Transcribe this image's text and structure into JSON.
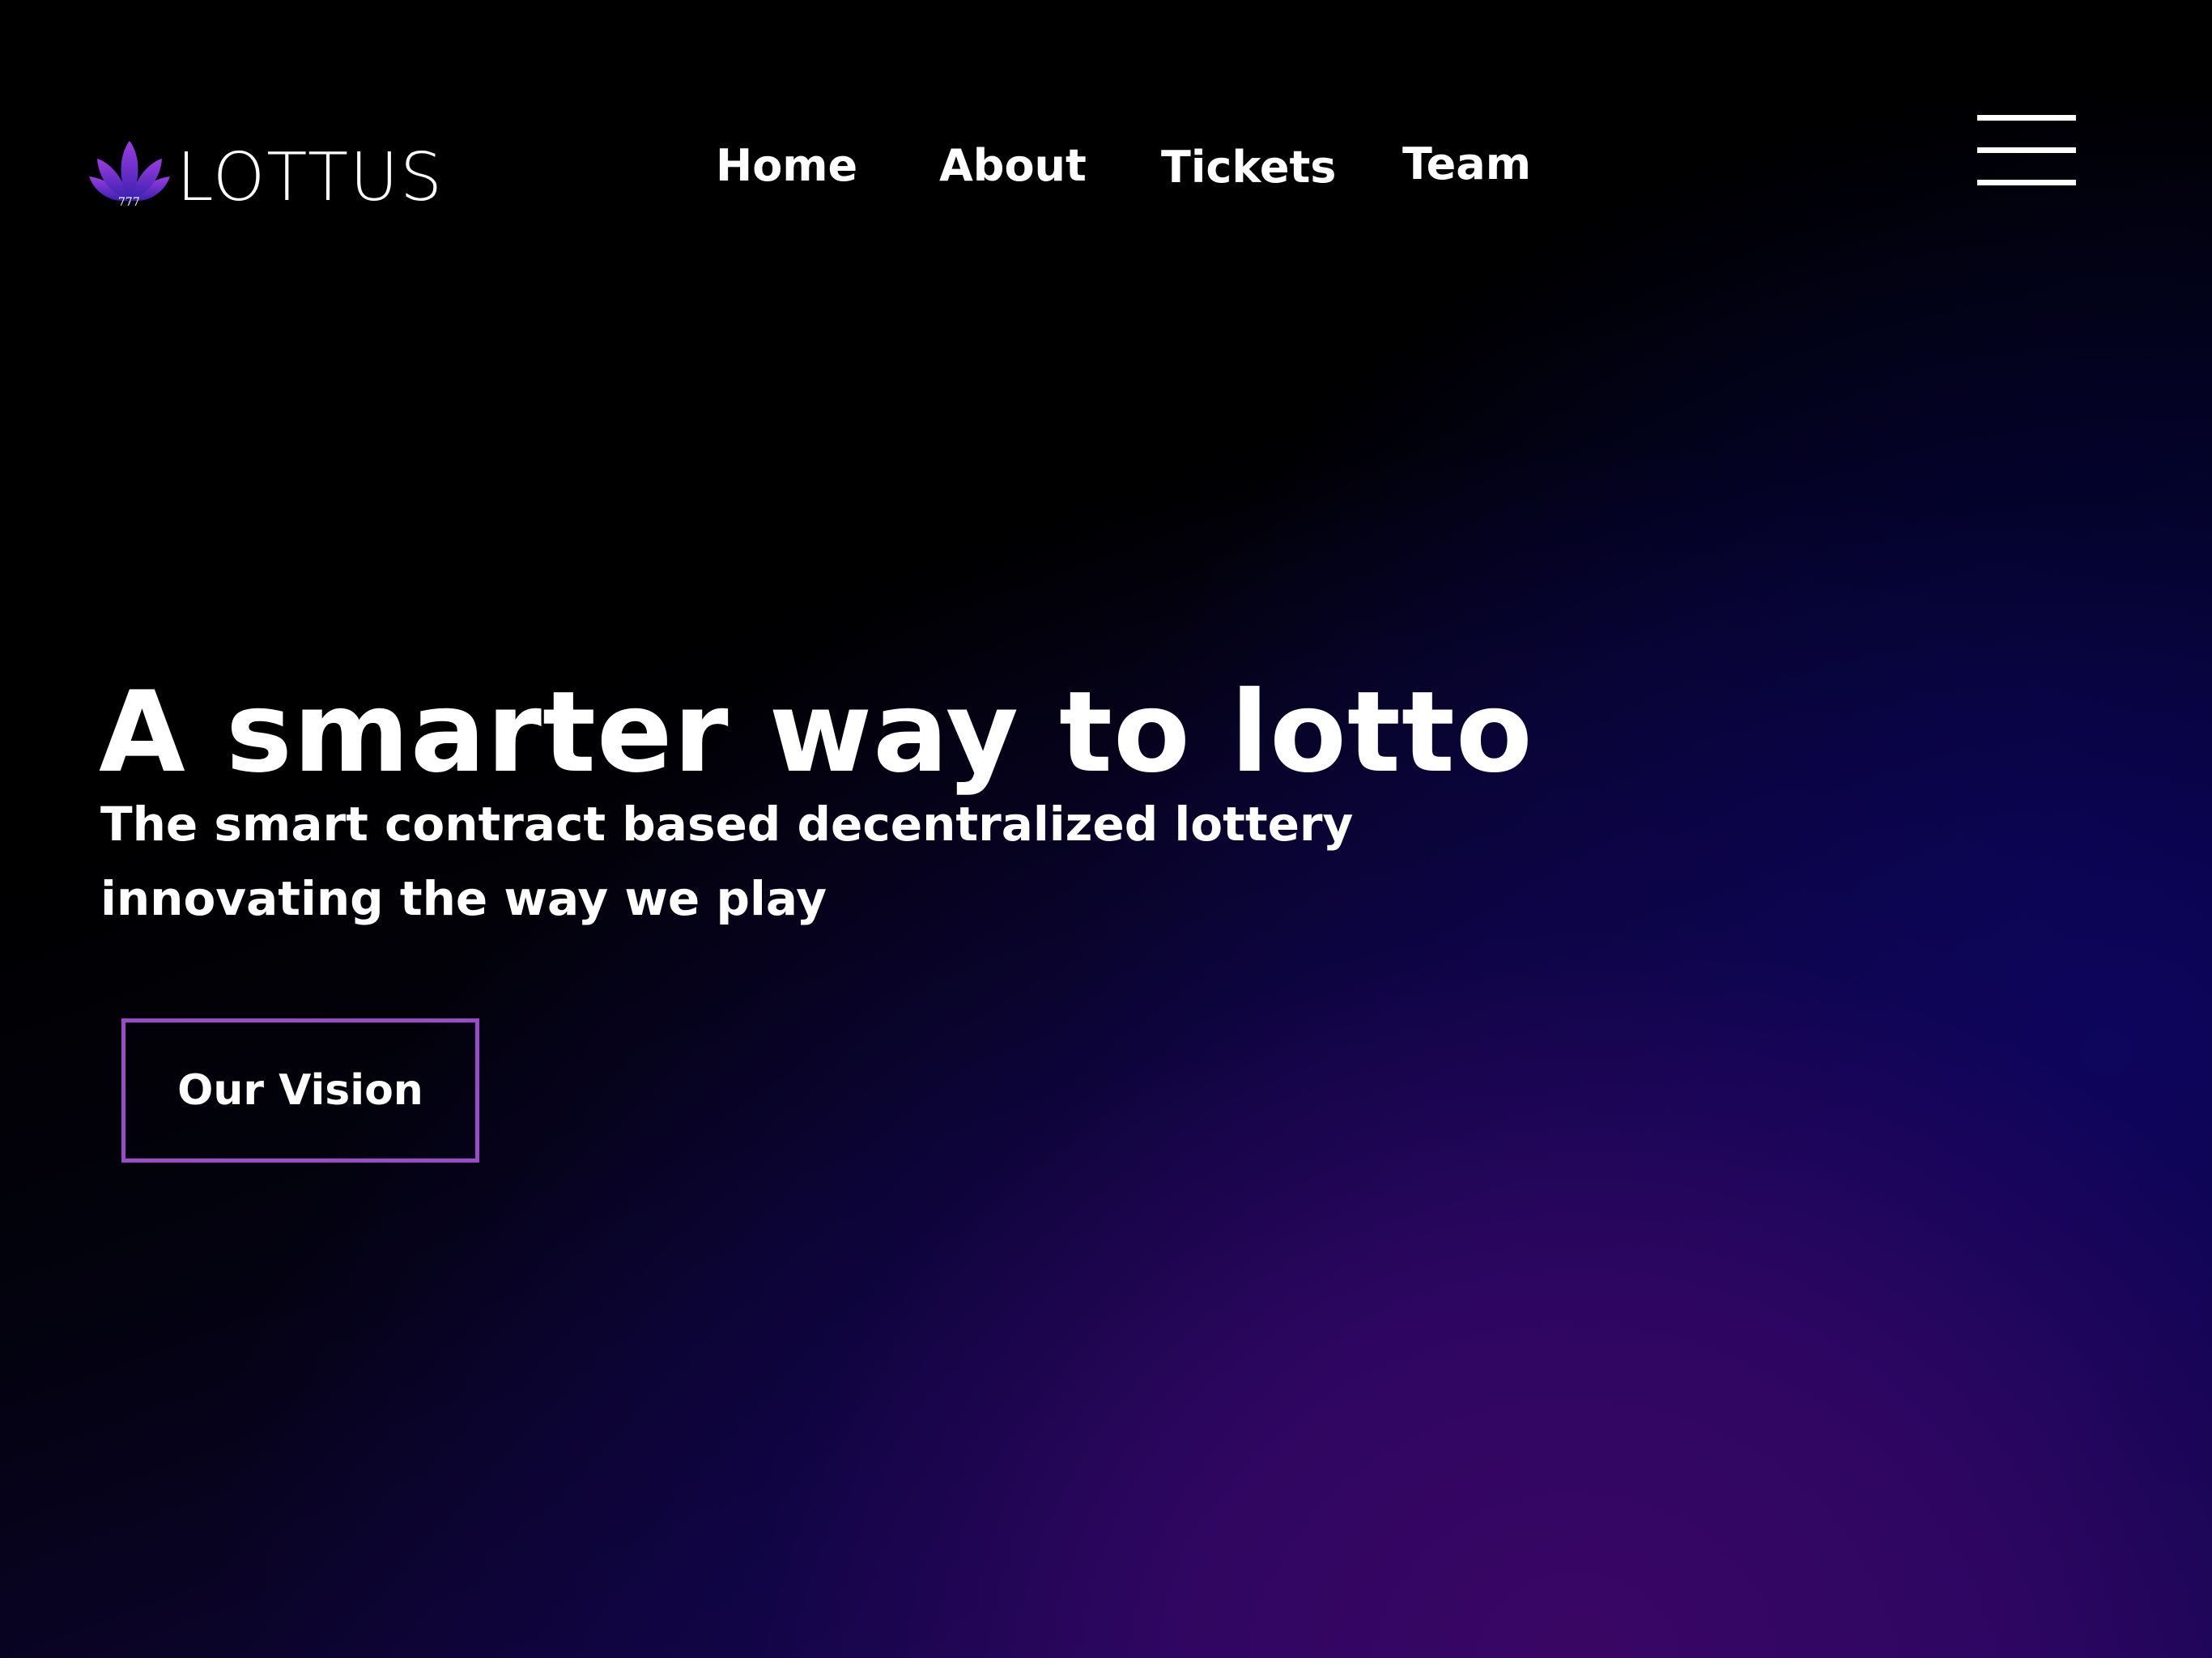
{
  "header": {
    "logo": {
      "text": "LOTTUS",
      "subtext": "777",
      "icon": "lotus-flower-icon"
    },
    "nav": [
      {
        "label": "Home"
      },
      {
        "label": "About"
      },
      {
        "label": "Tickets"
      },
      {
        "label": "Team"
      }
    ],
    "menu_icon": "hamburger-menu-icon"
  },
  "hero": {
    "title": "A smarter way to lotto",
    "subtitle": "The smart contract based decentralized lottery innovating the way we play",
    "cta_label": "Our Vision"
  },
  "colors": {
    "background_top": "#000000",
    "background_glow_purple": "#3a0664",
    "background_glow_blue": "#08045e",
    "button_border": "#9a4cc8",
    "logo_gradient_start": "#9a3ee0",
    "logo_gradient_end": "#3b1fb0",
    "text": "#ffffff"
  }
}
